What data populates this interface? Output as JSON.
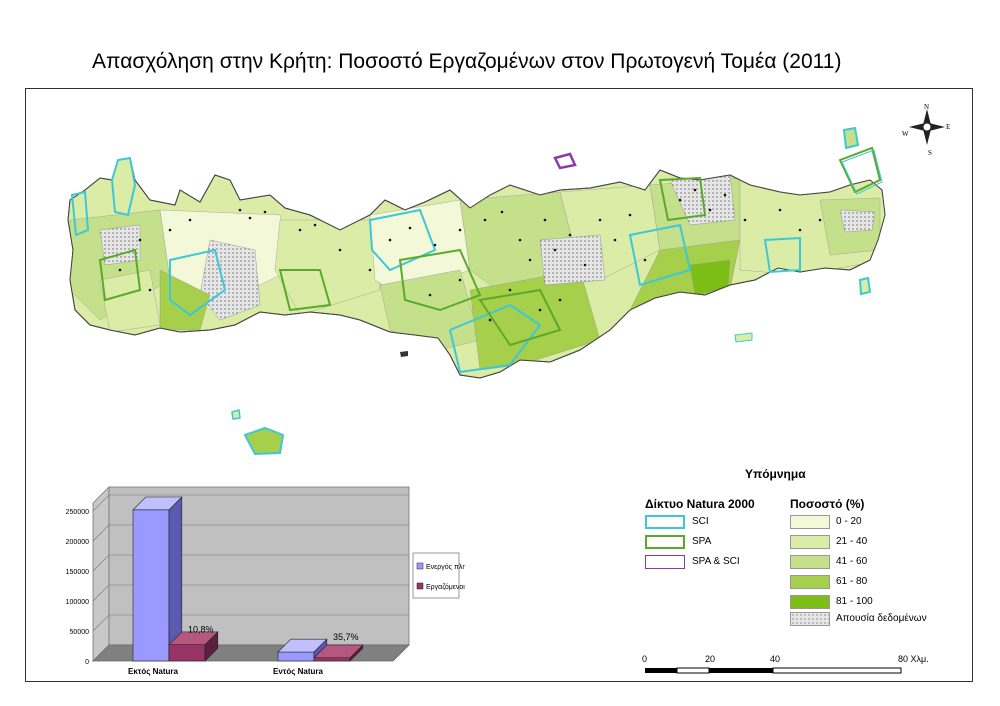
{
  "title": "Απασχόληση στην Κρήτη: Ποσοστό Εργαζομένων στον Πρωτογενή Τομέα (2011)",
  "compass": {
    "n": "N",
    "e": "E",
    "s": "S",
    "w": "W"
  },
  "legend": {
    "title": "Υπόμνημα",
    "natura_title": "Δίκτυο Natura 2000",
    "natura_items": [
      {
        "label": "SCI",
        "color": "#3cc8d8"
      },
      {
        "label": "SPA",
        "color": "#5aaa2a"
      },
      {
        "label": "SPA & SCI",
        "color": "#8a3aa8"
      }
    ],
    "percent_title": "Ποσοστό (%)",
    "percent_items": [
      {
        "label": "0 - 20",
        "color": "#f3f9d8"
      },
      {
        "label": "21 - 40",
        "color": "#dbeca6"
      },
      {
        "label": "41 - 60",
        "color": "#c5e08a"
      },
      {
        "label": "61 - 80",
        "color": "#a6cf4c"
      },
      {
        "label": "81 - 100",
        "color": "#7cbd16"
      }
    ],
    "no_data": "Απουσία δεδομένων"
  },
  "scale": {
    "labels": [
      "0",
      "20",
      "40",
      "80 Χλμ."
    ]
  },
  "chart_data": {
    "type": "bar",
    "categories": [
      "Εκτός Natura",
      "Εντός Natura"
    ],
    "series": [
      {
        "name": "Ενεργός πληθυσμός",
        "values": [
          252000,
          15000
        ],
        "color": "#9999ff"
      },
      {
        "name": "Εργαζόμενοι πρωτογενούς τομέα",
        "values": [
          27200,
          5400
        ],
        "color": "#993366"
      }
    ],
    "data_labels": [
      "10,8%",
      "35,7%"
    ],
    "ylim": [
      0,
      250000
    ],
    "yticks": [
      "0",
      "50000",
      "100000",
      "150000",
      "200000",
      "250000"
    ],
    "grid": true,
    "legend_position": "right"
  }
}
